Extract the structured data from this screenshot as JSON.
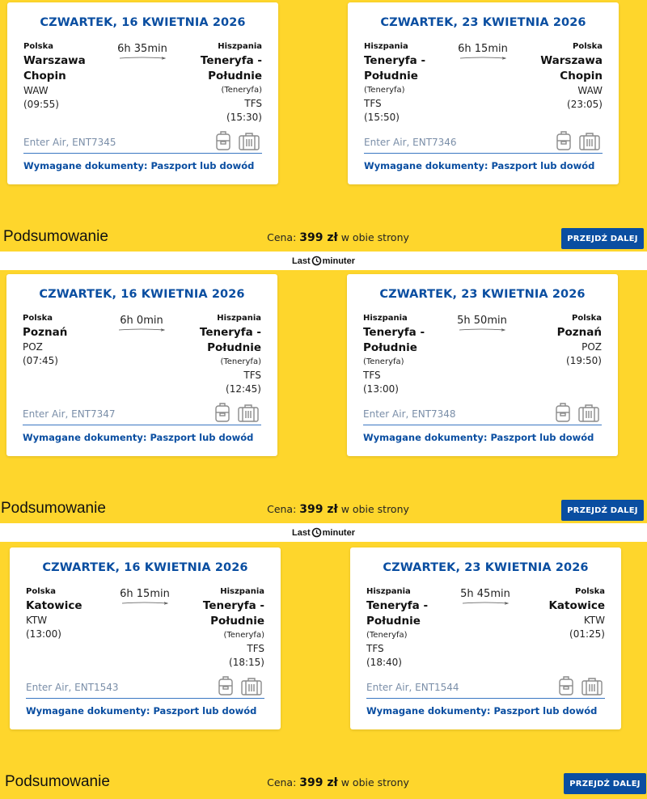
{
  "offers": [
    {
      "out": {
        "date": "CZWARTEK, 16 KWIETNIA 2026",
        "from": {
          "country": "Polska",
          "city": "Warszawa Chopin",
          "region": "",
          "code": "WAW",
          "time": "(09:55)"
        },
        "to": {
          "country": "Hiszpania",
          "city": "Teneryfa - Południe",
          "region": "(Teneryfa)",
          "code": "TFS",
          "time": "(15:30)"
        },
        "duration": "6h 35min",
        "airline": "Enter Air, ENT7345",
        "docs": "Wymagane dokumenty: Paszport lub dowód"
      },
      "ret": {
        "date": "CZWARTEK, 23 KWIETNIA 2026",
        "from": {
          "country": "Hiszpania",
          "city": "Teneryfa - Południe",
          "region": "(Teneryfa)",
          "code": "TFS",
          "time": "(15:50)"
        },
        "to": {
          "country": "Polska",
          "city": "Warszawa Chopin",
          "region": "",
          "code": "WAW",
          "time": "(23:05)"
        },
        "duration": "6h 15min",
        "airline": "Enter Air, ENT7346",
        "docs": "Wymagane dokumenty: Paszport lub dowód"
      },
      "summary": "Podsumowanie",
      "price_prefix": "Cena:",
      "price": "399 zł",
      "price_suffix": "w obie strony",
      "button": "PRZEJDŹ DALEJ"
    },
    {
      "out": {
        "date": "CZWARTEK, 16 KWIETNIA 2026",
        "from": {
          "country": "Polska",
          "city": "Poznań",
          "region": "",
          "code": "POZ",
          "time": "(07:45)"
        },
        "to": {
          "country": "Hiszpania",
          "city": "Teneryfa - Południe",
          "region": "(Teneryfa)",
          "code": "TFS",
          "time": "(12:45)"
        },
        "duration": "6h 0min",
        "airline": "Enter Air, ENT7347",
        "docs": "Wymagane dokumenty: Paszport lub dowód"
      },
      "ret": {
        "date": "CZWARTEK, 23 KWIETNIA 2026",
        "from": {
          "country": "Hiszpania",
          "city": "Teneryfa - Południe",
          "region": "(Teneryfa)",
          "code": "TFS",
          "time": "(13:00)"
        },
        "to": {
          "country": "Polska",
          "city": "Poznań",
          "region": "",
          "code": "POZ",
          "time": "(19:50)"
        },
        "duration": "5h 50min",
        "airline": "Enter Air, ENT7348",
        "docs": "Wymagane dokumenty: Paszport lub dowód"
      },
      "summary": "Podsumowanie",
      "price_prefix": "Cena:",
      "price": "399 zł",
      "price_suffix": "w obie strony",
      "button": "PRZEJDŹ DALEJ"
    },
    {
      "out": {
        "date": "CZWARTEK, 16 KWIETNIA 2026",
        "from": {
          "country": "Polska",
          "city": "Katowice",
          "region": "",
          "code": "KTW",
          "time": "(13:00)"
        },
        "to": {
          "country": "Hiszpania",
          "city": "Teneryfa - Południe",
          "region": "(Teneryfa)",
          "code": "TFS",
          "time": "(18:15)"
        },
        "duration": "6h 15min",
        "airline": "Enter Air, ENT1543",
        "docs": "Wymagane dokumenty: Paszport lub dowód"
      },
      "ret": {
        "date": "CZWARTEK, 23 KWIETNIA 2026",
        "from": {
          "country": "Hiszpania",
          "city": "Teneryfa - Południe",
          "region": "(Teneryfa)",
          "code": "TFS",
          "time": "(18:40)"
        },
        "to": {
          "country": "Polska",
          "city": "Katowice",
          "region": "",
          "code": "KTW",
          "time": "(01:25)"
        },
        "duration": "5h 45min",
        "airline": "Enter Air, ENT1544",
        "docs": "Wymagane dokumenty: Paszport lub dowód"
      },
      "summary": "Podsumowanie",
      "price_prefix": "Cena:",
      "price": "399 zł",
      "price_suffix": "w obie strony",
      "button": "PRZEJDŹ DALEJ"
    }
  ],
  "logo": {
    "left": "Last",
    "right": "minuter"
  },
  "colors": {
    "background": "#fed62c",
    "accent": "#0a4ea1",
    "muted": "#7a8ea8"
  },
  "icons": [
    "hand-luggage-icon",
    "suitcase-icon",
    "clock-icon"
  ]
}
